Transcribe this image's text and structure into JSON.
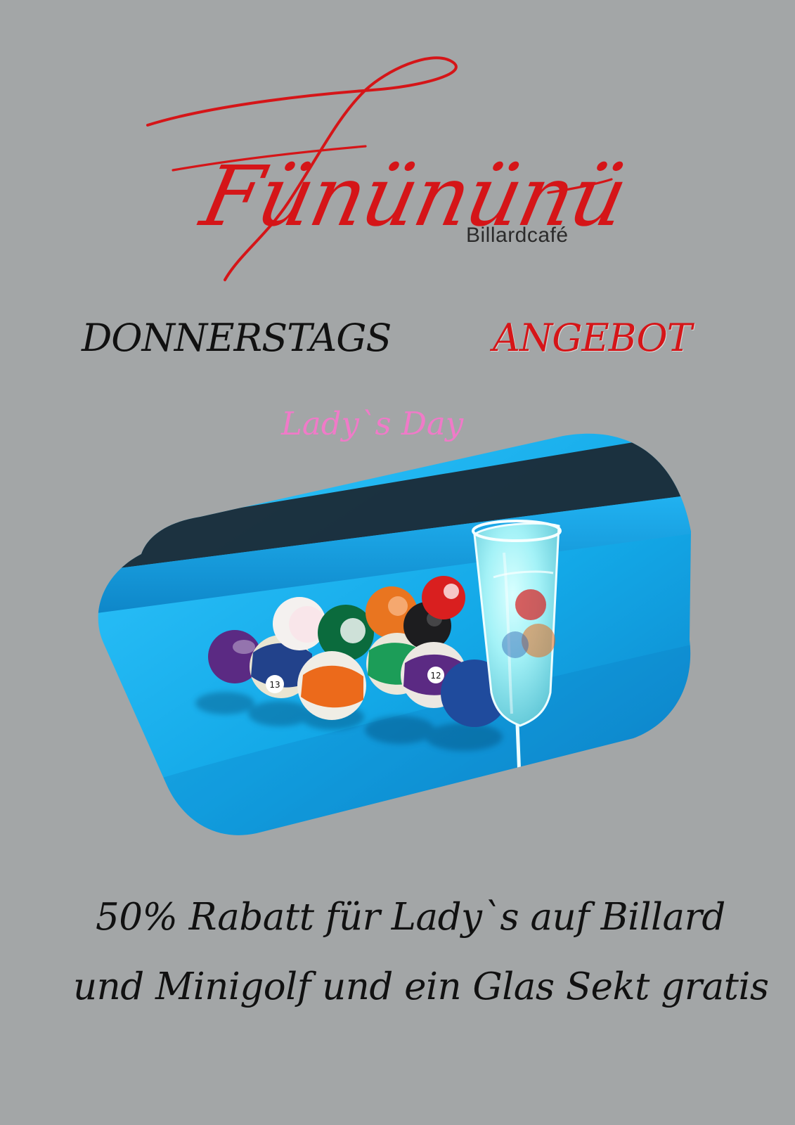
{
  "brand": {
    "name": "Fünününü",
    "subtitle": "Billardcafé"
  },
  "headline": {
    "left": "DONNERSTAGS",
    "right": "ANGEBOT"
  },
  "tagline": "Lady`s Day",
  "photo": {
    "ball_labels": [
      "12",
      "13"
    ]
  },
  "offer": {
    "line_1": "50% Rabatt für Lady`s auf Billard",
    "line_2": "und Minigolf und ein Glas Sekt gratis"
  },
  "colors": {
    "background": "#a3a6a7",
    "brand_red": "#d51518",
    "text_dark": "#111111",
    "pink": "#f07ac8",
    "felt_blue": "#12a9e3"
  }
}
